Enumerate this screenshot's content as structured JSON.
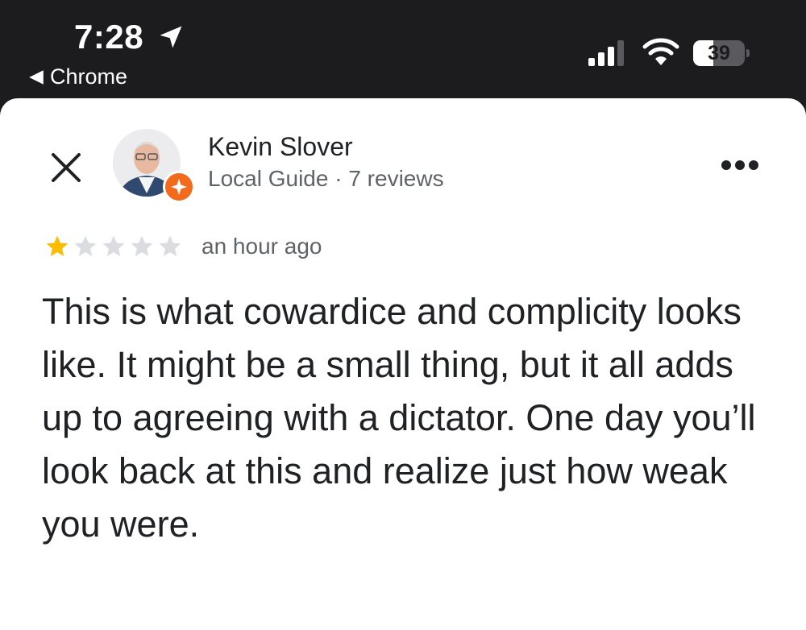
{
  "status_bar": {
    "time": "7:28",
    "back_app": "Chrome",
    "battery_level": 39,
    "battery_text": "39"
  },
  "reviewer": {
    "name": "Kevin Slover",
    "subtitle": "Local Guide · 7 reviews"
  },
  "review": {
    "rating": 1,
    "max_rating": 5,
    "time_ago": "an hour ago",
    "text": "This is what cowardice and complicity looks like. It might be a small thing, but it all adds up to agreeing with a dictator. One day you’ll look back at this and realize just how weak you were."
  },
  "colors": {
    "star_filled": "#fbbc04",
    "star_empty": "#dadce0",
    "local_guide_badge": "#f36a1c"
  },
  "icons": [
    "location-arrow-icon",
    "back-triangle-icon",
    "cellular-signal-icon",
    "wifi-icon",
    "battery-icon",
    "close-icon",
    "local-guide-badge-icon",
    "more-options-icon",
    "star-icon"
  ]
}
